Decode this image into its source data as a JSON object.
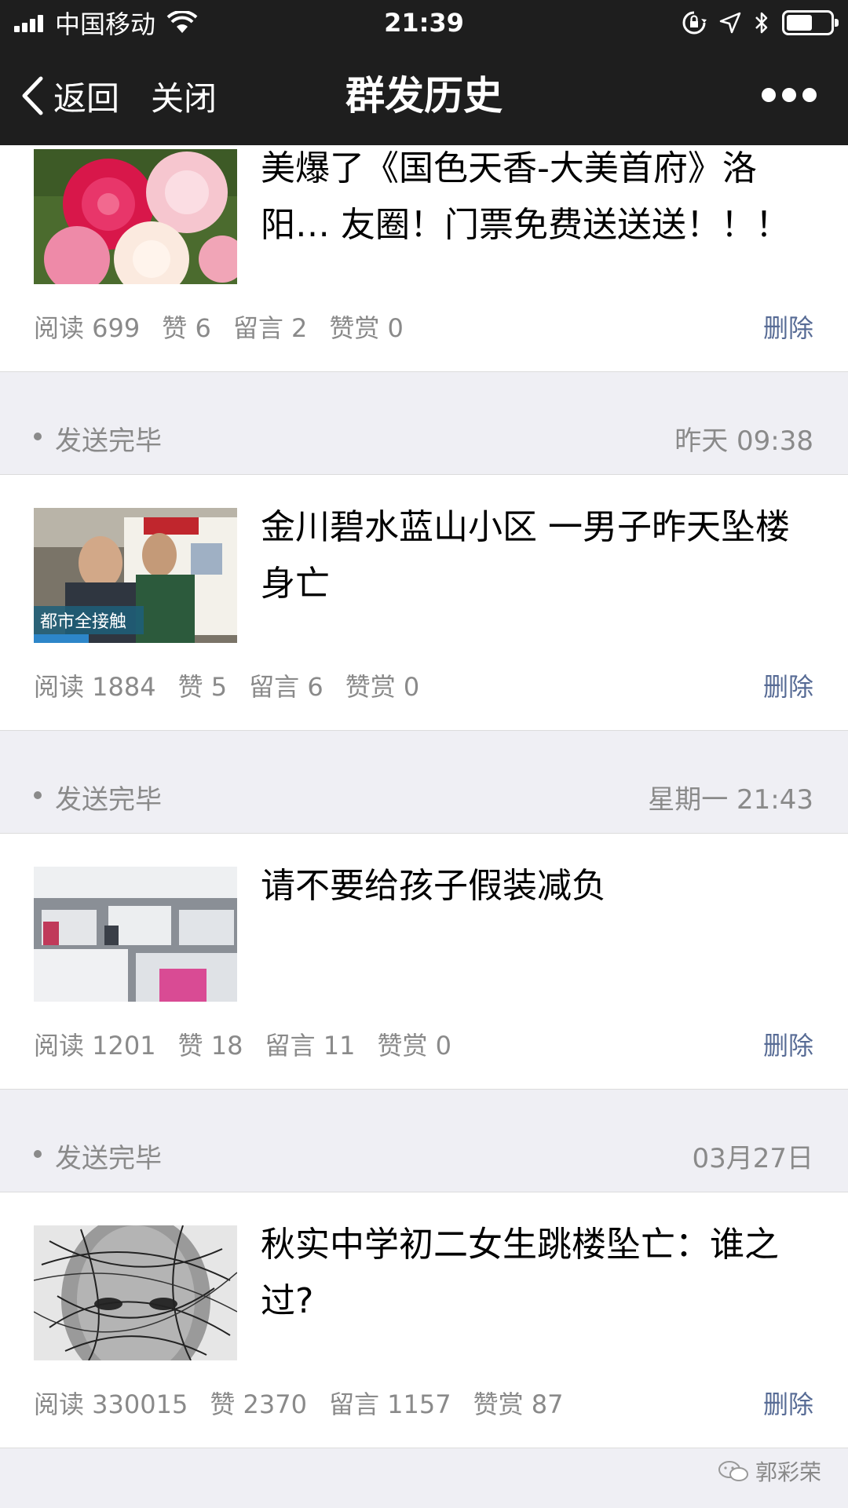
{
  "status_bar": {
    "carrier": "中国移动",
    "time": "21:39"
  },
  "nav": {
    "back_label": "返回",
    "close_label": "关闭",
    "title": "群发历史"
  },
  "articles": [
    {
      "title": "美爆了《国色天香-大美首府》洛阳… 友圈！门票免费送送送！！！",
      "stats": {
        "read": "阅读 699",
        "like": "赞 6",
        "comment": "留言 2",
        "reward": "赞赏 0"
      },
      "delete_label": "删除",
      "thumb_icon": "peony-flowers-image"
    },
    {
      "title": "金川碧水蓝山小区 一男子昨天坠楼身亡",
      "stats": {
        "read": "阅读 1884",
        "like": "赞 5",
        "comment": "留言 6",
        "reward": "赞赏 0"
      },
      "delete_label": "删除",
      "thumb_icon": "news-ambulance-image",
      "thumb_caption": "都市全接触"
    },
    {
      "title": "请不要给孩子假装减负",
      "stats": {
        "read": "阅读 1201",
        "like": "赞 18",
        "comment": "留言 11",
        "reward": "赞赏 0"
      },
      "delete_label": "删除",
      "thumb_icon": "classroom-books-image"
    },
    {
      "title": "秋实中学初二女生跳楼坠亡：谁之过?",
      "stats": {
        "read": "阅读 330015",
        "like": "赞 2370",
        "comment": "留言 1157",
        "reward": "赞赏 87"
      },
      "delete_label": "删除",
      "thumb_icon": "face-lines-image"
    }
  ],
  "groups": [
    {
      "status": "发送完毕",
      "time": "昨天 09:38"
    },
    {
      "status": "发送完毕",
      "time": "星期一 21:43"
    },
    {
      "status": "发送完毕",
      "time": "03月27日"
    }
  ],
  "watermark": "郭彩荣",
  "colors": {
    "nav_bg": "#1e1e1e",
    "page_bg": "#efeff4",
    "link": "#576b95",
    "meta_text": "#8a8a8a"
  }
}
